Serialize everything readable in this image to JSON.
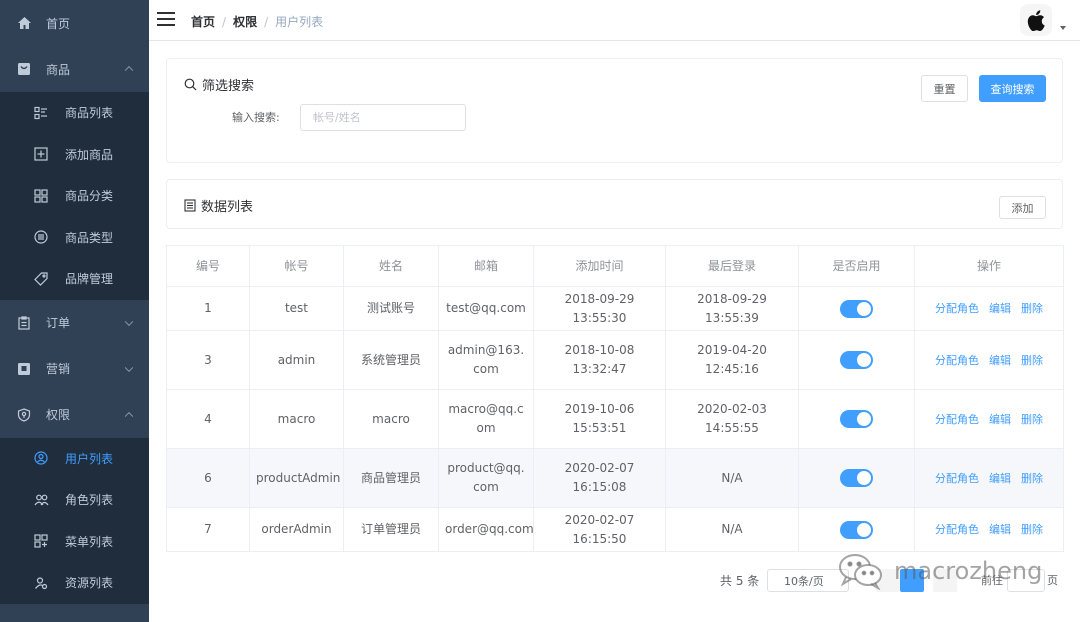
{
  "sidebar": {
    "items": [
      {
        "label": "首页",
        "icon": "home-icon"
      },
      {
        "label": "商品",
        "icon": "product-icon",
        "expanded": true,
        "children": [
          {
            "label": "商品列表",
            "icon": "list-icon"
          },
          {
            "label": "添加商品",
            "icon": "add-box-icon"
          },
          {
            "label": "商品分类",
            "icon": "grid-icon"
          },
          {
            "label": "商品类型",
            "icon": "type-icon"
          },
          {
            "label": "品牌管理",
            "icon": "tag-icon"
          }
        ]
      },
      {
        "label": "订单",
        "icon": "order-icon",
        "expanded": false
      },
      {
        "label": "营销",
        "icon": "marketing-icon",
        "expanded": false
      },
      {
        "label": "权限",
        "icon": "permission-icon",
        "expanded": true,
        "children": [
          {
            "label": "用户列表",
            "icon": "user-icon",
            "active": true
          },
          {
            "label": "角色列表",
            "icon": "role-icon"
          },
          {
            "label": "菜单列表",
            "icon": "menu-icon"
          },
          {
            "label": "资源列表",
            "icon": "resource-icon"
          }
        ]
      }
    ]
  },
  "header": {
    "breadcrumb": [
      "首页",
      "权限",
      "用户列表"
    ],
    "avatar_icon": "apple-icon"
  },
  "filter": {
    "title": "筛选搜索",
    "search_label": "输入搜索:",
    "search_placeholder": "帐号/姓名",
    "reset_label": "重置",
    "query_label": "查询搜索"
  },
  "list": {
    "title": "数据列表",
    "add_label": "添加"
  },
  "table": {
    "headers": [
      "编号",
      "帐号",
      "姓名",
      "邮箱",
      "添加时间",
      "最后登录",
      "是否启用",
      "操作"
    ],
    "rows": [
      {
        "id": "1",
        "account": "test",
        "name": "测试账号",
        "email": "test@qq.com",
        "created": "2018-09-29 13:55:30",
        "last_login": "2018-09-29 13:55:39",
        "enabled": true
      },
      {
        "id": "3",
        "account": "admin",
        "name": "系统管理员",
        "email": "admin@163.com",
        "created": "2018-10-08 13:32:47",
        "last_login": "2019-04-20 12:45:16",
        "enabled": true
      },
      {
        "id": "4",
        "account": "macro",
        "name": "macro",
        "email": "macro@qq.com",
        "created": "2019-10-06 15:53:51",
        "last_login": "2020-02-03 14:55:55",
        "enabled": true
      },
      {
        "id": "6",
        "account": "productAdmin",
        "name": "商品管理员",
        "email": "product@qq.com",
        "created": "2020-02-07 16:15:08",
        "last_login": "N/A",
        "enabled": true
      },
      {
        "id": "7",
        "account": "orderAdmin",
        "name": "订单管理员",
        "email": "order@qq.com",
        "created": "2020-02-07 16:15:50",
        "last_login": "N/A",
        "enabled": true
      }
    ],
    "actions": {
      "assign_role": "分配角色",
      "edit": "编辑",
      "delete": "删除"
    }
  },
  "pagination": {
    "total_text": "共 5 条",
    "page_size": "10条/页",
    "goto_label": "前往",
    "goto_unit": "页"
  },
  "watermark": {
    "text": "macrozheng"
  },
  "colors": {
    "sidebar_bg": "#304156",
    "submenu_bg": "#1f2d3d",
    "primary": "#409eff"
  }
}
